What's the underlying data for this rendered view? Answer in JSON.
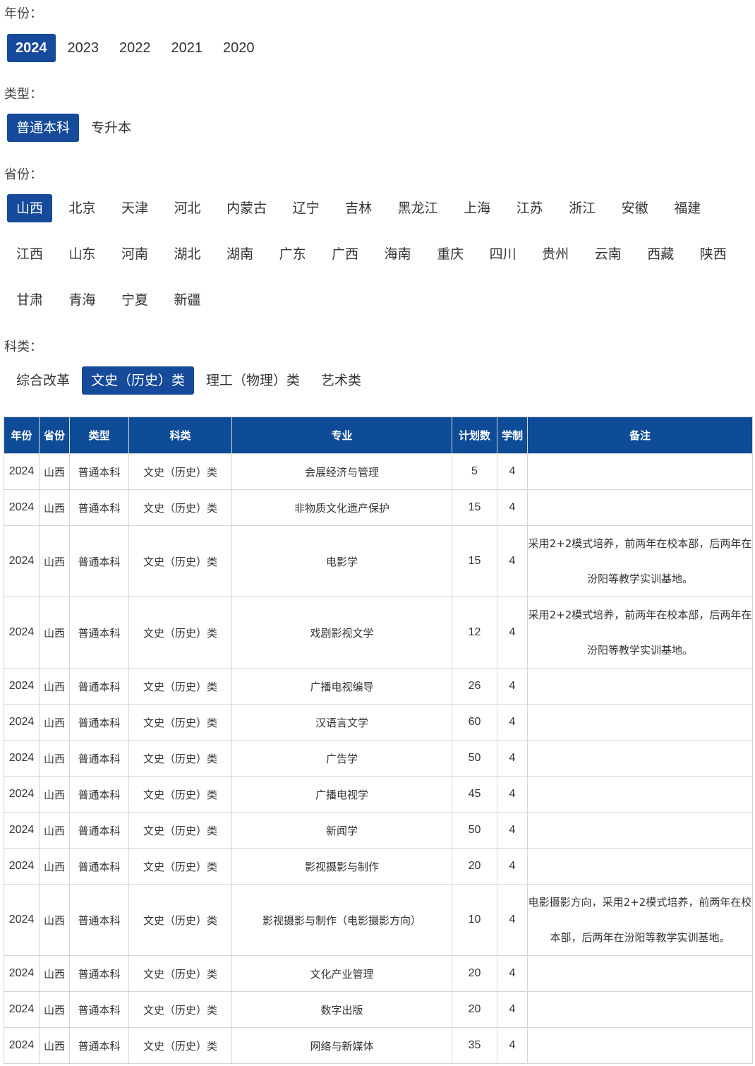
{
  "filters": {
    "year": {
      "label": "年份：",
      "options": [
        "2024",
        "2023",
        "2022",
        "2021",
        "2020"
      ],
      "selected": "2024"
    },
    "type": {
      "label": "类型：",
      "options": [
        "普通本科",
        "专升本"
      ],
      "selected": "普通本科"
    },
    "province": {
      "label": "省份：",
      "options": [
        "山西",
        "北京",
        "天津",
        "河北",
        "内蒙古",
        "辽宁",
        "吉林",
        "黑龙江",
        "上海",
        "江苏",
        "浙江",
        "安徽",
        "福建",
        "江西",
        "山东",
        "河南",
        "湖北",
        "湖南",
        "广东",
        "广西",
        "海南",
        "重庆",
        "四川",
        "贵州",
        "云南",
        "西藏",
        "陕西",
        "甘肃",
        "青海",
        "宁夏",
        "新疆"
      ],
      "selected": "山西"
    },
    "category": {
      "label": "科类：",
      "options": [
        "综合改革",
        "文史（历史）类",
        "理工（物理）类",
        "艺术类"
      ],
      "selected": "文史（历史）类"
    }
  },
  "table": {
    "headers": [
      "年份",
      "省份",
      "类型",
      "科类",
      "专业",
      "计划数",
      "学制",
      "备注"
    ],
    "rows": [
      [
        "2024",
        "山西",
        "普通本科",
        "文史（历史）类",
        "会展经济与管理",
        "5",
        "4",
        ""
      ],
      [
        "2024",
        "山西",
        "普通本科",
        "文史（历史）类",
        "非物质文化遗产保护",
        "15",
        "4",
        ""
      ],
      [
        "2024",
        "山西",
        "普通本科",
        "文史（历史）类",
        "电影学",
        "15",
        "4",
        "采用2+2模式培养，前两年在校本部，后两年在汾阳等教学实训基地。"
      ],
      [
        "2024",
        "山西",
        "普通本科",
        "文史（历史）类",
        "戏剧影视文学",
        "12",
        "4",
        "采用2+2模式培养，前两年在校本部，后两年在汾阳等教学实训基地。"
      ],
      [
        "2024",
        "山西",
        "普通本科",
        "文史（历史）类",
        "广播电视编导",
        "26",
        "4",
        ""
      ],
      [
        "2024",
        "山西",
        "普通本科",
        "文史（历史）类",
        "汉语言文学",
        "60",
        "4",
        ""
      ],
      [
        "2024",
        "山西",
        "普通本科",
        "文史（历史）类",
        "广告学",
        "50",
        "4",
        ""
      ],
      [
        "2024",
        "山西",
        "普通本科",
        "文史（历史）类",
        "广播电视学",
        "45",
        "4",
        ""
      ],
      [
        "2024",
        "山西",
        "普通本科",
        "文史（历史）类",
        "新闻学",
        "50",
        "4",
        ""
      ],
      [
        "2024",
        "山西",
        "普通本科",
        "文史（历史）类",
        "影视摄影与制作",
        "20",
        "4",
        ""
      ],
      [
        "2024",
        "山西",
        "普通本科",
        "文史（历史）类",
        "影视摄影与制作（电影摄影方向）",
        "10",
        "4",
        "电影摄影方向，采用2+2模式培养，前两年在校本部，后两年在汾阳等教学实训基地。"
      ],
      [
        "2024",
        "山西",
        "普通本科",
        "文史（历史）类",
        "文化产业管理",
        "20",
        "4",
        ""
      ],
      [
        "2024",
        "山西",
        "普通本科",
        "文史（历史）类",
        "数字出版",
        "20",
        "4",
        ""
      ],
      [
        "2024",
        "山西",
        "普通本科",
        "文史（历史）类",
        "网络与新媒体",
        "35",
        "4",
        ""
      ]
    ]
  },
  "colors": {
    "accent": "#164a9a",
    "header_bg": "#0f4c97",
    "border": "#d5d5d5"
  }
}
